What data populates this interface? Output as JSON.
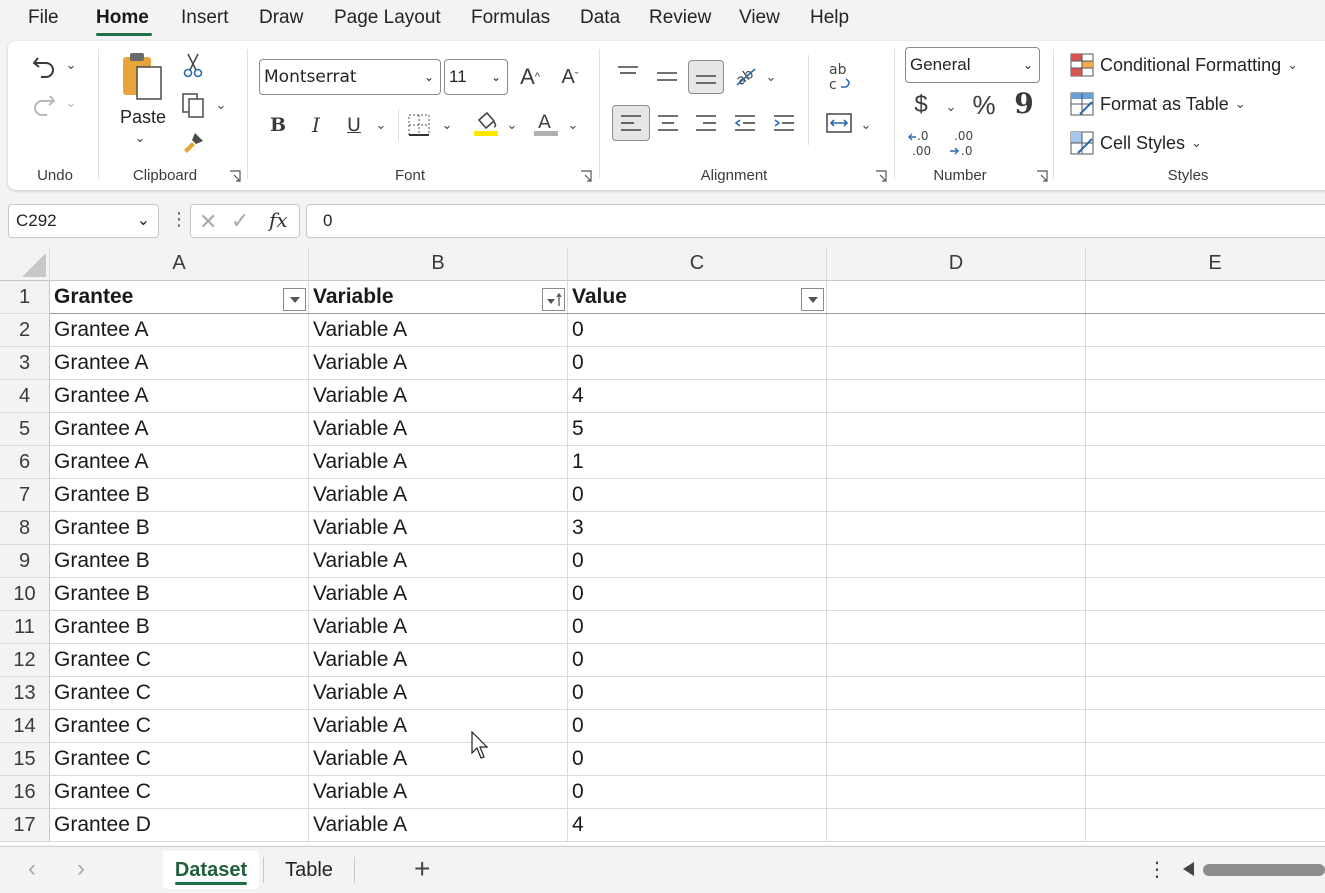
{
  "menu": {
    "items": [
      "File",
      "Home",
      "Insert",
      "Draw",
      "Page Layout",
      "Formulas",
      "Data",
      "Review",
      "View",
      "Help"
    ],
    "active": "Home"
  },
  "ribbon": {
    "undo": {
      "label": "Undo"
    },
    "clipboard": {
      "label": "Clipboard",
      "paste_label": "Paste"
    },
    "font": {
      "label": "Font",
      "family": "Montserrat",
      "size": "11",
      "bold": "B",
      "italic": "I",
      "underline": "U"
    },
    "alignment": {
      "label": "Alignment"
    },
    "number": {
      "label": "Number",
      "format": "General",
      "currency": "$",
      "percent": "%",
      "comma": "9"
    },
    "styles": {
      "label": "Styles",
      "conditional_formatting": "Conditional Formatting",
      "format_as_table": "Format as Table",
      "cell_styles": "Cell Styles"
    },
    "colors": {
      "accent": "#1f7145",
      "highlight": "#ffe800",
      "font_color": "#b0b0b0"
    }
  },
  "formula_bar": {
    "name_box": "C292",
    "fx": "fx",
    "value": "0"
  },
  "grid": {
    "columns": [
      "A",
      "B",
      "C",
      "D",
      "E"
    ],
    "header_row": {
      "row": "1",
      "cells": [
        "Grantee",
        "Variable",
        "Value"
      ]
    },
    "rows": [
      {
        "n": "2",
        "a": "Grantee A",
        "b": "Variable A",
        "c": "0"
      },
      {
        "n": "3",
        "a": "Grantee A",
        "b": "Variable A",
        "c": "0"
      },
      {
        "n": "4",
        "a": "Grantee A",
        "b": "Variable A",
        "c": "4"
      },
      {
        "n": "5",
        "a": "Grantee A",
        "b": "Variable A",
        "c": "5"
      },
      {
        "n": "6",
        "a": "Grantee A",
        "b": "Variable A",
        "c": "1"
      },
      {
        "n": "7",
        "a": "Grantee B",
        "b": "Variable A",
        "c": "0"
      },
      {
        "n": "8",
        "a": "Grantee B",
        "b": "Variable A",
        "c": "3"
      },
      {
        "n": "9",
        "a": "Grantee B",
        "b": "Variable A",
        "c": "0"
      },
      {
        "n": "10",
        "a": "Grantee B",
        "b": "Variable A",
        "c": "0"
      },
      {
        "n": "11",
        "a": "Grantee B",
        "b": "Variable A",
        "c": "0"
      },
      {
        "n": "12",
        "a": "Grantee C",
        "b": "Variable A",
        "c": "0"
      },
      {
        "n": "13",
        "a": "Grantee C",
        "b": "Variable A",
        "c": "0"
      },
      {
        "n": "14",
        "a": "Grantee C",
        "b": "Variable A",
        "c": "0"
      },
      {
        "n": "15",
        "a": "Grantee C",
        "b": "Variable A",
        "c": "0"
      },
      {
        "n": "16",
        "a": "Grantee C",
        "b": "Variable A",
        "c": "0"
      },
      {
        "n": "17",
        "a": "Grantee D",
        "b": "Variable A",
        "c": "4"
      }
    ]
  },
  "sheets": {
    "tabs": [
      "Dataset",
      "Table"
    ],
    "active": "Dataset",
    "add": "+"
  }
}
